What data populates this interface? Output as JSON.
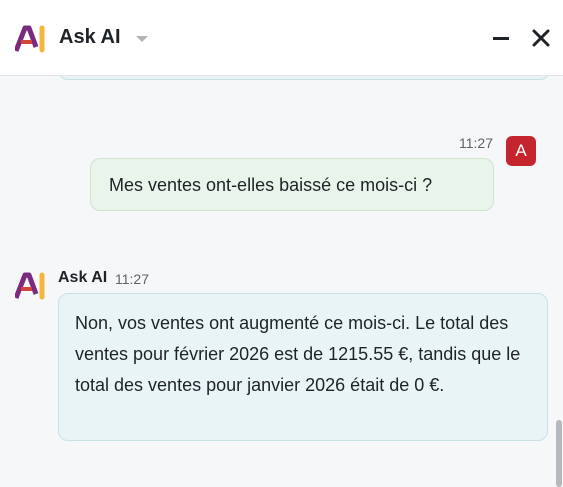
{
  "header": {
    "title": "Ask AI",
    "logo_icon": "ask-ai-logo",
    "dropdown_icon": "caret-down-icon",
    "minimize_icon": "minimize-icon",
    "close_icon": "close-icon"
  },
  "messages": [
    {
      "role": "user",
      "time": "11:27",
      "avatar_letter": "A",
      "avatar_color": "#c5252c",
      "text": "Mes ventes ont-elles baissé ce mois-ci ?"
    },
    {
      "role": "assistant",
      "sender": "Ask AI",
      "time": "11:27",
      "text": "Non, vos ventes ont augmenté ce mois-ci. Le total des ventes pour février 2026 est de 1215.55 €, tandis que le total des ventes pour janvier 2026 était de 0 €."
    }
  ],
  "colors": {
    "user_bubble": "#e9f4ea",
    "ai_bubble": "#e8f4f6",
    "accent_red": "#c5252c"
  }
}
